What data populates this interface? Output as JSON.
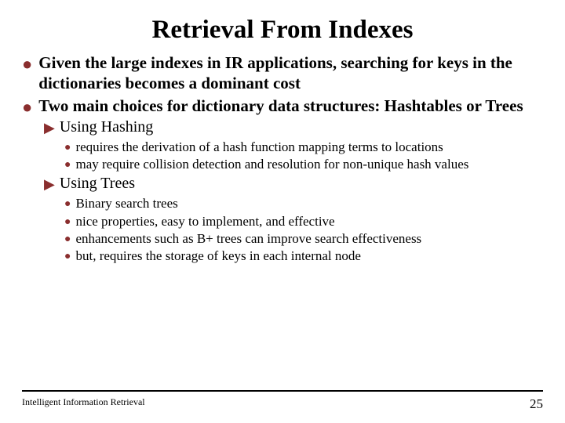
{
  "title": "Retrieval From Indexes",
  "b1_0": "Given the large indexes in IR applications, searching for keys in the dictionaries becomes a dominant cost",
  "b1_1": "Two main choices for dictionary data structures: Hashtables or Trees",
  "b2_0": "Using Hashing",
  "b3_0": "requires the derivation of a hash function mapping terms to locations",
  "b3_1": "may require collision detection and resolution for non-unique hash values",
  "b2_1": "Using Trees",
  "b3_2": "Binary search trees",
  "b3_3": "nice properties, easy to implement, and effective",
  "b3_4": "enhancements such as B+ trees can improve search effectiveness",
  "b3_5": "but, requires the storage of keys in each internal node",
  "footer_text": "Intelligent Information Retrieval",
  "page_number": "25",
  "glyphs": {
    "dot": "●",
    "tri": "▶"
  }
}
